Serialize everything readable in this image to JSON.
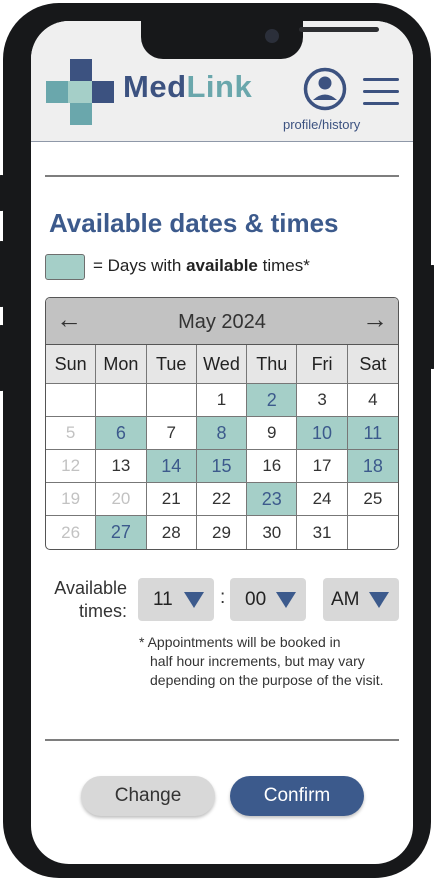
{
  "colors": {
    "primary": "#3c5a8c",
    "available": "#a5cfc8",
    "logo_dark": "#3c5280",
    "logo_teal": "#6aa7ac"
  },
  "header": {
    "brand_part1": "Med",
    "brand_part2": "Link",
    "profile_label": "profile/history",
    "icons": [
      "logo-cross-icon",
      "profile-icon",
      "menu-icon"
    ]
  },
  "main": {
    "title": "Available dates & times",
    "legend_prefix": "= Days with ",
    "legend_bold": "available",
    "legend_suffix": " times*"
  },
  "calendar": {
    "month": "May 2024",
    "prev_icon": "arrow-left-icon",
    "next_icon": "arrow-right-icon",
    "weekdays": [
      "Sun",
      "Mon",
      "Tue",
      "Wed",
      "Thu",
      "Fri",
      "Sat"
    ],
    "weeks": [
      [
        {
          "day": ""
        },
        {
          "day": ""
        },
        {
          "day": ""
        },
        {
          "day": "1"
        },
        {
          "day": "2",
          "available": true
        },
        {
          "day": "3"
        },
        {
          "day": "4"
        }
      ],
      [
        {
          "day": "5",
          "muted": true
        },
        {
          "day": "6",
          "available": true
        },
        {
          "day": "7"
        },
        {
          "day": "8",
          "available": true
        },
        {
          "day": "9"
        },
        {
          "day": "10",
          "available": true
        },
        {
          "day": "11",
          "available": true
        }
      ],
      [
        {
          "day": "12",
          "muted": true
        },
        {
          "day": "13"
        },
        {
          "day": "14",
          "available": true
        },
        {
          "day": "15",
          "available": true
        },
        {
          "day": "16"
        },
        {
          "day": "17"
        },
        {
          "day": "18",
          "available": true
        }
      ],
      [
        {
          "day": "19",
          "muted": true
        },
        {
          "day": "20",
          "muted": true
        },
        {
          "day": "21"
        },
        {
          "day": "22"
        },
        {
          "day": "23",
          "available": true
        },
        {
          "day": "24"
        },
        {
          "day": "25"
        }
      ],
      [
        {
          "day": "26",
          "muted": true
        },
        {
          "day": "27",
          "available": true
        },
        {
          "day": "28"
        },
        {
          "day": "29"
        },
        {
          "day": "30"
        },
        {
          "day": "31"
        },
        {
          "day": ""
        }
      ]
    ]
  },
  "times": {
    "label_line1": "Available",
    "label_line2": "times:",
    "hour": "11",
    "separator": ":",
    "minute": "00",
    "period": "AM",
    "note_line1": "* Appointments will be booked in",
    "note_line2": "half hour increments, but may vary depending on the purpose of the visit."
  },
  "actions": {
    "change_label": "Change",
    "confirm_label": "Confirm"
  }
}
